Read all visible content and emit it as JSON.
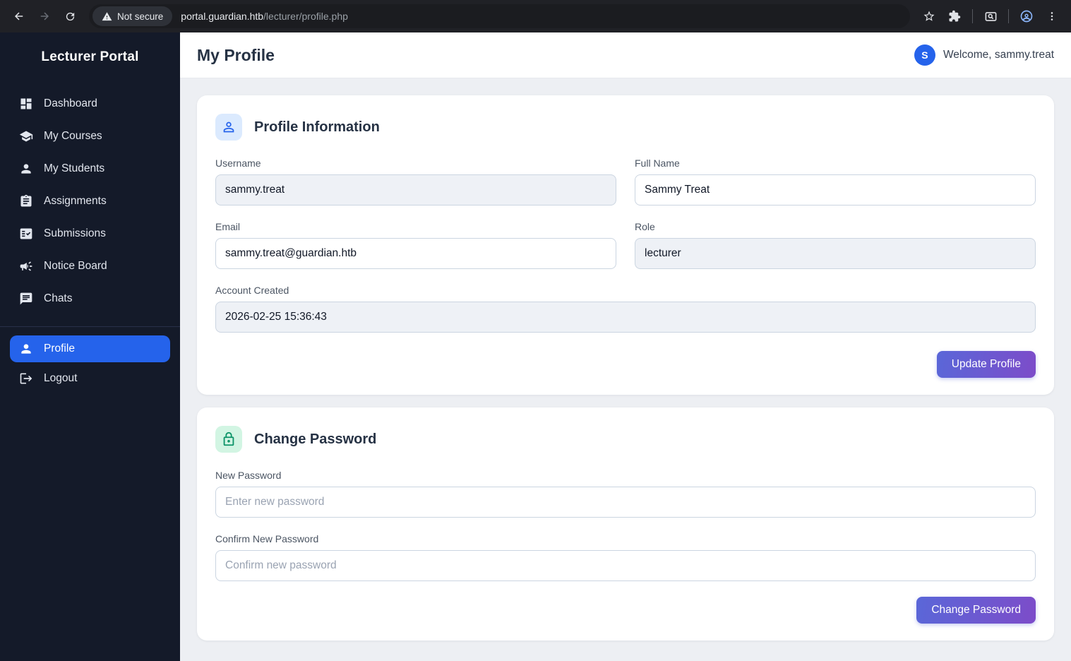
{
  "browser": {
    "security_chip": "Not secure",
    "url_host": "portal.guardian.htb",
    "url_path": "/lecturer/profile.php"
  },
  "sidebar": {
    "title": "Lecturer Portal",
    "items": [
      {
        "label": "Dashboard",
        "icon": "dashboard-icon"
      },
      {
        "label": "My Courses",
        "icon": "graduation-cap-icon"
      },
      {
        "label": "My Students",
        "icon": "person-icon"
      },
      {
        "label": "Assignments",
        "icon": "clipboard-icon"
      },
      {
        "label": "Submissions",
        "icon": "fact-check-icon"
      },
      {
        "label": "Notice Board",
        "icon": "megaphone-icon"
      },
      {
        "label": "Chats",
        "icon": "chat-bubble-icon"
      }
    ],
    "profile_label": "Profile",
    "logout_label": "Logout",
    "active_item": "Profile"
  },
  "header": {
    "title": "My Profile",
    "avatar_initial": "S",
    "welcome": "Welcome, sammy.treat"
  },
  "profile_card": {
    "title": "Profile Information",
    "fields": {
      "username": {
        "label": "Username",
        "value": "sammy.treat"
      },
      "full_name": {
        "label": "Full Name",
        "value": "Sammy Treat"
      },
      "email": {
        "label": "Email",
        "value": "sammy.treat@guardian.htb"
      },
      "role": {
        "label": "Role",
        "value": "lecturer"
      },
      "account_created": {
        "label": "Account Created",
        "value": "2026-02-25 15:36:43"
      }
    },
    "submit_label": "Update Profile"
  },
  "password_card": {
    "title": "Change Password",
    "fields": {
      "new_password": {
        "label": "New Password",
        "placeholder": "Enter new password"
      },
      "confirm_password": {
        "label": "Confirm New Password",
        "placeholder": "Confirm new password"
      }
    },
    "submit_label": "Change Password"
  },
  "colors": {
    "sidebar_bg": "#141a29",
    "active_nav": "#2563eb",
    "avatar": "#2563eb",
    "button_gradient_start": "#5a67d8",
    "button_gradient_end": "#7d4cc9",
    "profile_icon_bg": "#dbeafe",
    "profile_icon": "#2563eb",
    "lock_icon_bg": "#d2f5e3",
    "lock_icon": "#0d9468"
  }
}
